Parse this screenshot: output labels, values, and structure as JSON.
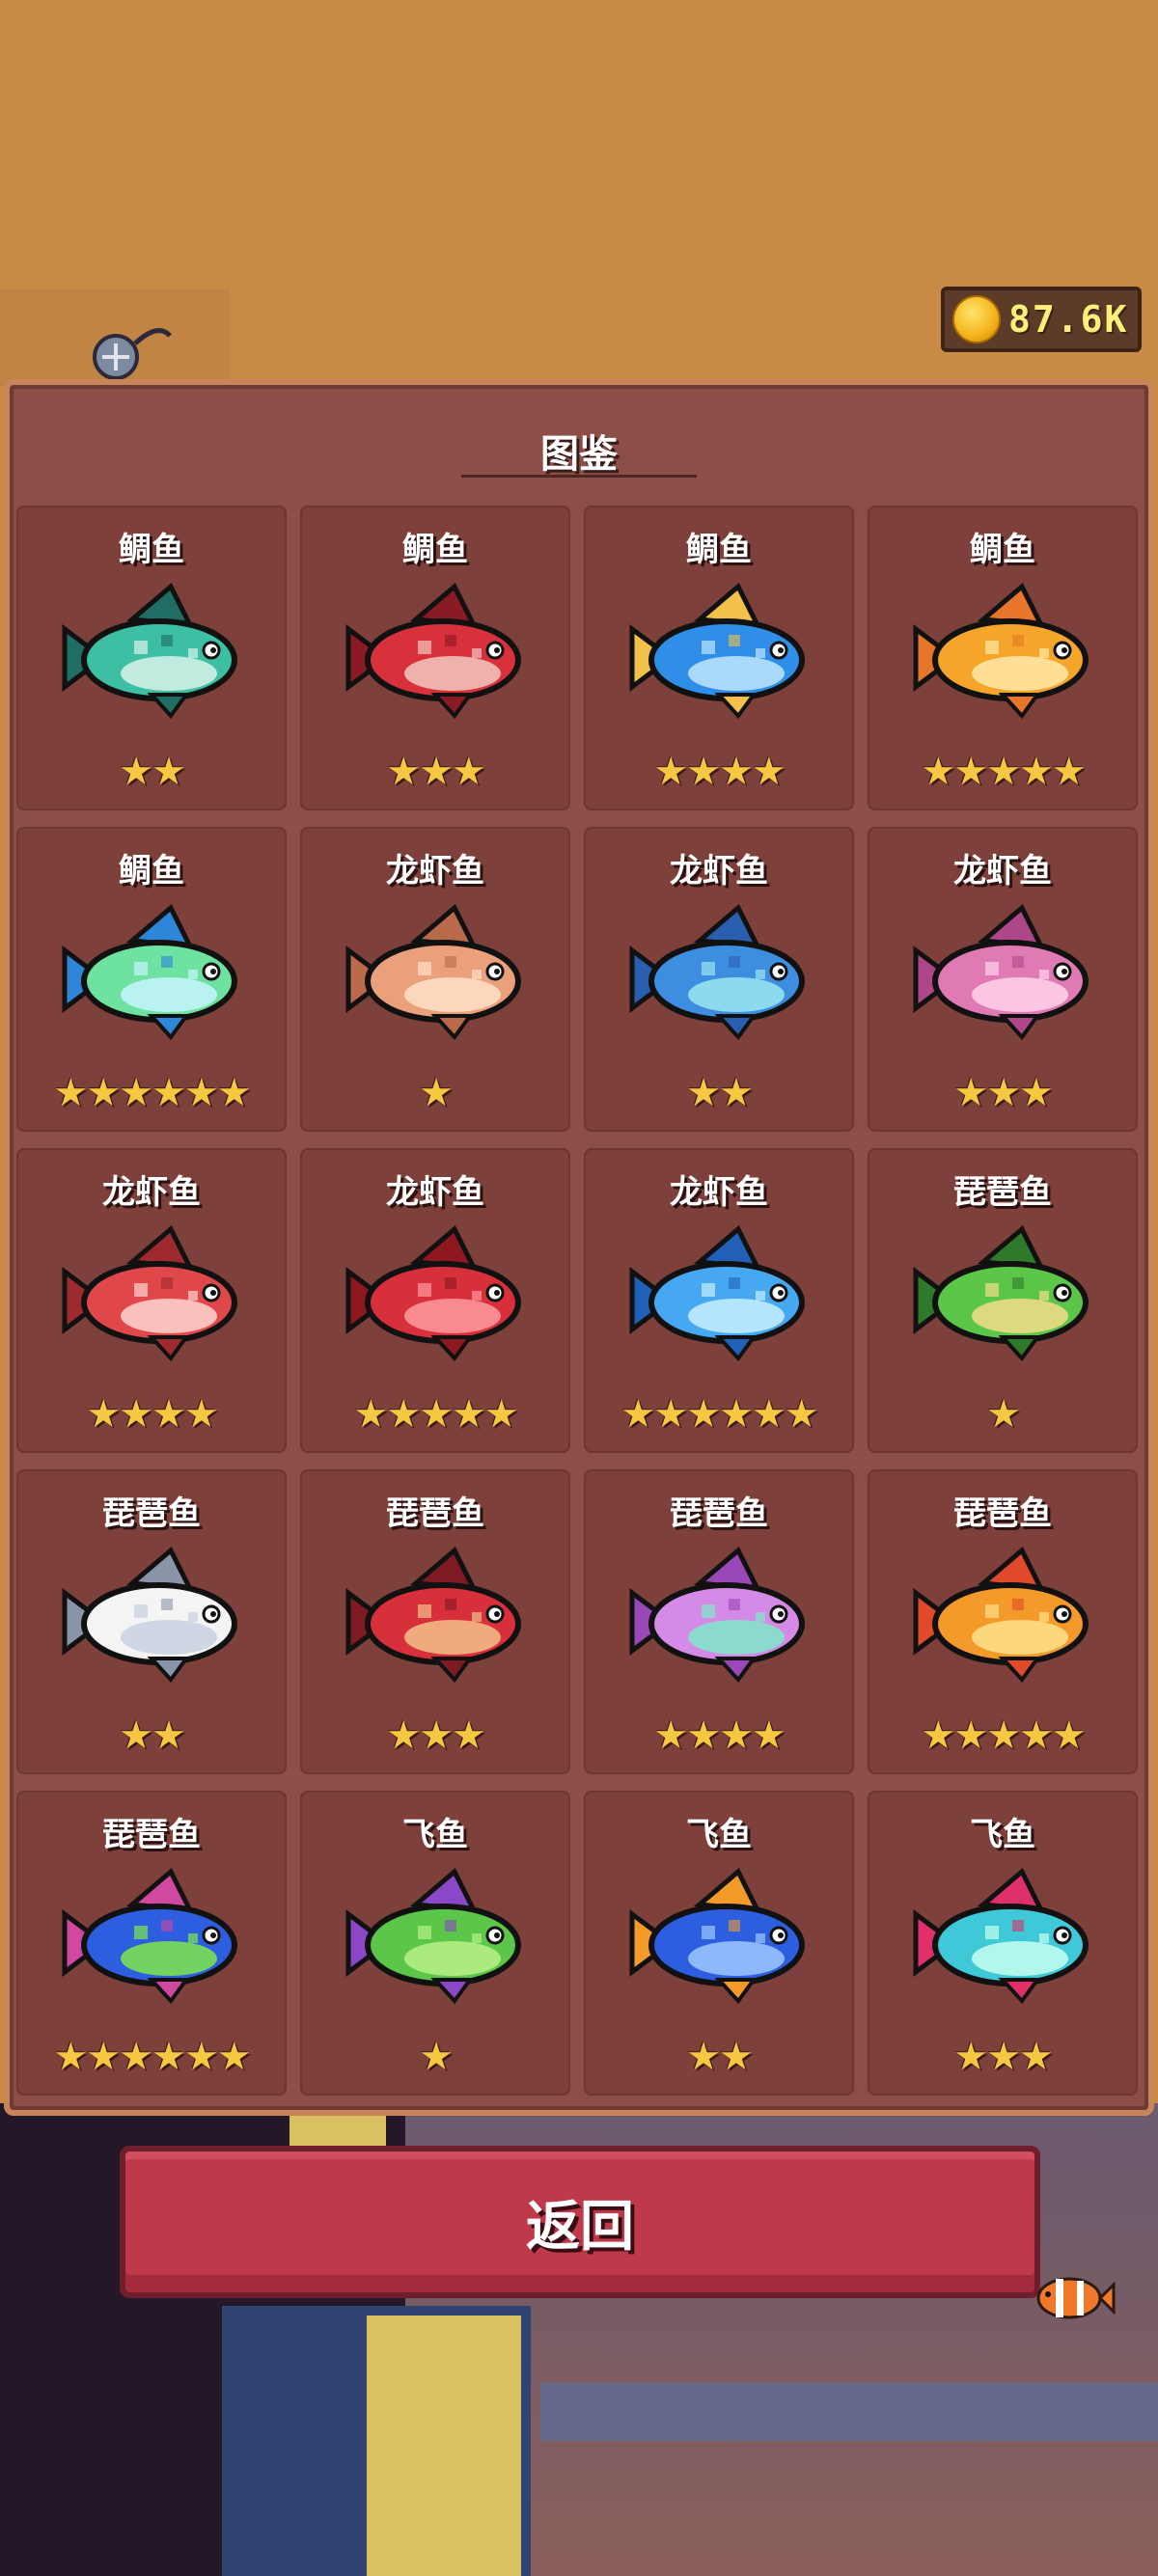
{
  "currency": {
    "coins": "87.6K",
    "icon": "gold-coin-icon"
  },
  "panel": {
    "title": "图鉴"
  },
  "fish_cards": [
    {
      "name": "鲷鱼",
      "stars": "★★",
      "colors": [
        "#3dbfa4",
        "#d8f2ea",
        "#1f6d63"
      ]
    },
    {
      "name": "鲷鱼",
      "stars": "★★★",
      "colors": [
        "#d8313c",
        "#f2c8c0",
        "#8a1a24"
      ]
    },
    {
      "name": "鲷鱼",
      "stars": "★★★★",
      "colors": [
        "#2f8ee8",
        "#bfe6ff",
        "#f2c14a"
      ]
    },
    {
      "name": "鲷鱼",
      "stars": "★★★★★",
      "colors": [
        "#f4a52a",
        "#ffe9a8",
        "#e7752a"
      ]
    },
    {
      "name": "鲷鱼",
      "stars": "★★★★★★",
      "colors": [
        "#6ee2a0",
        "#c7f5ff",
        "#2e86d8"
      ]
    },
    {
      "name": "龙虾鱼",
      "stars": "★",
      "colors": [
        "#eaa07a",
        "#ffe1c8",
        "#b86a4a"
      ]
    },
    {
      "name": "龙虾鱼",
      "stars": "★★",
      "colors": [
        "#3d8ee0",
        "#9be6f0",
        "#2a5fb0"
      ]
    },
    {
      "name": "龙虾鱼",
      "stars": "★★★",
      "colors": [
        "#e07ab4",
        "#ffd3ea",
        "#b0468a"
      ]
    },
    {
      "name": "龙虾鱼",
      "stars": "★★★★",
      "colors": [
        "#e0474a",
        "#ffd6d0",
        "#9e2a30"
      ]
    },
    {
      "name": "龙虾鱼",
      "stars": "★★★★★",
      "colors": [
        "#d8303a",
        "#ff9aa0",
        "#8e1820"
      ]
    },
    {
      "name": "龙虾鱼",
      "stars": "★★★★★★",
      "colors": [
        "#46a8f0",
        "#c8f0ff",
        "#2060b8"
      ]
    },
    {
      "name": "琵琶鱼",
      "stars": "★",
      "colors": [
        "#5cc648",
        "#f4dc8a",
        "#2e7a2a"
      ]
    },
    {
      "name": "琵琶鱼",
      "stars": "★★",
      "colors": [
        "#f4f4f4",
        "#c8d0e0",
        "#8a94a8"
      ]
    },
    {
      "name": "琵琶鱼",
      "stars": "★★★",
      "colors": [
        "#d8303a",
        "#f4c08a",
        "#7e1a24"
      ]
    },
    {
      "name": "琵琶鱼",
      "stars": "★★★★",
      "colors": [
        "#d48ae6",
        "#7ee8c8",
        "#9a48b8"
      ]
    },
    {
      "name": "琵琶鱼",
      "stars": "★★★★★",
      "colors": [
        "#f49a2a",
        "#ffe08a",
        "#e04a2a"
      ]
    },
    {
      "name": "琵琶鱼",
      "stars": "★★★★★★",
      "colors": [
        "#2e5ee0",
        "#7ee84a",
        "#d048a0"
      ]
    },
    {
      "name": "飞鱼",
      "stars": "★",
      "colors": [
        "#5cc648",
        "#b8f08a",
        "#8a48c8"
      ]
    },
    {
      "name": "飞鱼",
      "stars": "★★",
      "colors": [
        "#2e5ee0",
        "#9ec8ff",
        "#f49a2a"
      ]
    },
    {
      "name": "飞鱼",
      "stars": "★★★",
      "colors": [
        "#3ec8d8",
        "#c8fff0",
        "#e0306a"
      ]
    }
  ],
  "back_button": {
    "label": "返回"
  }
}
